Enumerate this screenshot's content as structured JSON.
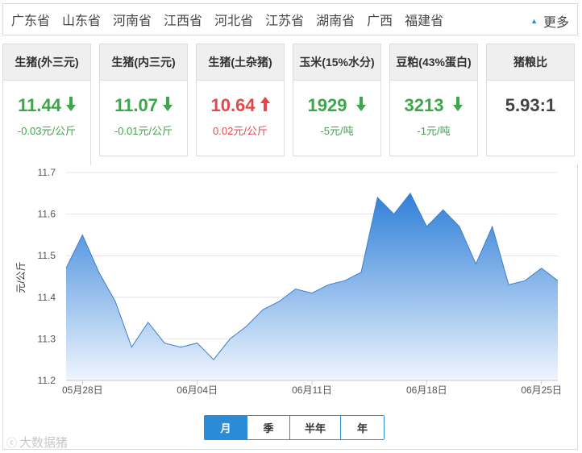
{
  "provinces": [
    "广东省",
    "山东省",
    "河南省",
    "江西省",
    "河北省",
    "江苏省",
    "湖南省",
    "广西",
    "福建省"
  ],
  "more_label": "更多",
  "cards": [
    {
      "title": "生猪(外三元)",
      "price": "11.44",
      "change": "-0.03元/公斤",
      "trend": "down"
    },
    {
      "title": "生猪(内三元)",
      "price": "11.07",
      "change": "-0.01元/公斤",
      "trend": "down"
    },
    {
      "title": "生猪(土杂猪)",
      "price": "10.64",
      "change": "0.02元/公斤",
      "trend": "up"
    },
    {
      "title": "玉米(15%水分)",
      "price": "1929",
      "change": "-5元/吨",
      "trend": "down"
    },
    {
      "title": "豆粕(43%蛋白)",
      "price": "3213",
      "change": "-1元/吨",
      "trend": "down"
    },
    {
      "title": "猪粮比",
      "price": "5.93:1",
      "change": "",
      "trend": "none"
    }
  ],
  "colors": {
    "down": "#3ba74a",
    "up": "#e5484a",
    "accent": "#2a8bd8",
    "area_top": "#2f7fd8",
    "area_bottom": "#eef5fd"
  },
  "periods": [
    "月",
    "季",
    "半年",
    "年"
  ],
  "active_period": "月",
  "watermark": "大数据猪",
  "chart_data": {
    "type": "area",
    "ylabel": "元/公斤",
    "ylim": [
      11.2,
      11.7
    ],
    "yticks": [
      "11.7",
      "11.6",
      "11.5",
      "11.4",
      "11.3",
      "11.2"
    ],
    "xtick_labels": [
      "05月28日",
      "06月04日",
      "06月11日",
      "06月18日",
      "06月25日"
    ],
    "xtick_index": [
      1,
      8,
      15,
      22,
      29
    ],
    "grid": true,
    "series": [
      {
        "values": [
          11.47,
          11.55,
          11.46,
          11.39,
          11.28,
          11.34,
          11.29,
          11.28,
          11.29,
          11.25,
          11.3,
          11.33,
          11.37,
          11.39,
          11.42,
          11.41,
          11.43,
          11.44,
          11.46,
          11.64,
          11.6,
          11.65,
          11.57,
          11.61,
          11.57,
          11.48,
          11.57,
          11.43,
          11.44,
          11.47,
          11.44
        ]
      }
    ]
  }
}
